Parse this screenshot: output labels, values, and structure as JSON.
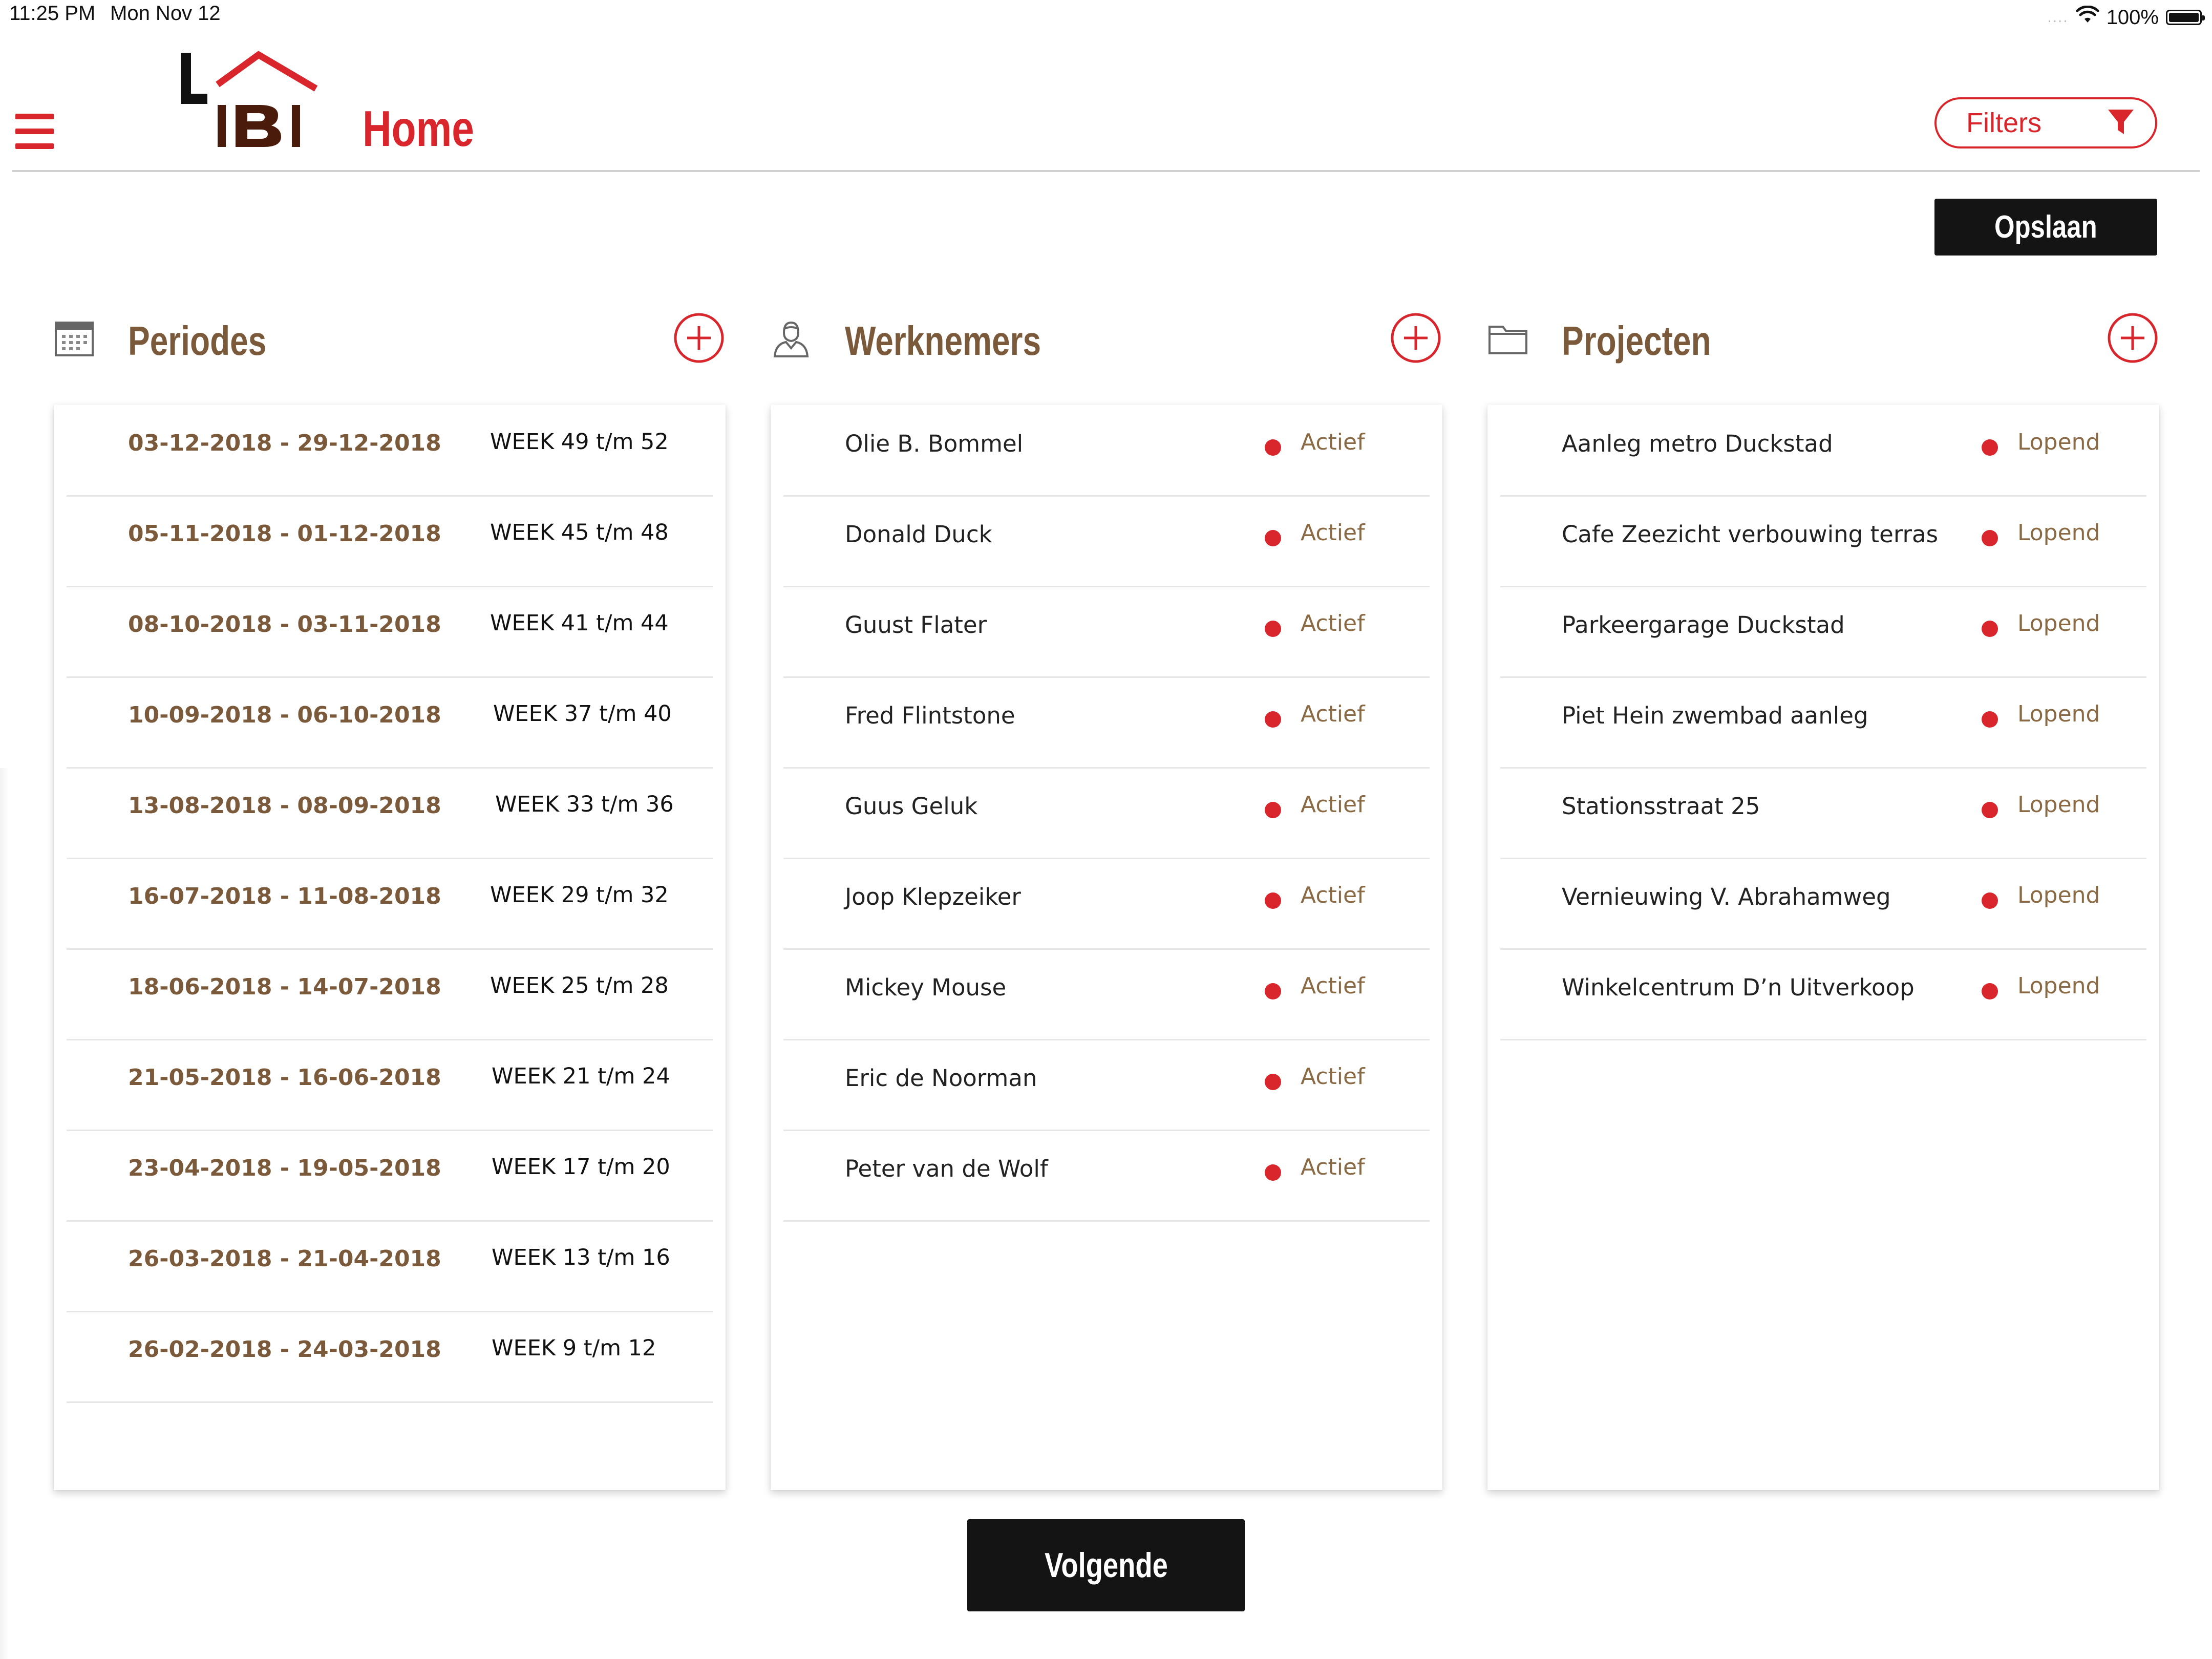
{
  "status_bar": {
    "time": "11:25 PM",
    "date": "Mon Nov 12",
    "signal": "....",
    "battery": "100%"
  },
  "header": {
    "title": "Home",
    "filters_label": "Filters",
    "save_label": "Opslaan"
  },
  "colors": {
    "accent": "#d8262c",
    "brown": "#7a5a3a",
    "dark": "#141414"
  },
  "columns": {
    "periodes": {
      "title": "Periodes",
      "icon": "calendar-icon",
      "rows": [
        {
          "range": "03-12-2018 - 29-12-2018",
          "weeks": "WEEK 49 t/m 52"
        },
        {
          "range": "05-11-2018 - 01-12-2018",
          "weeks": "WEEK 45 t/m 48"
        },
        {
          "range": "08-10-2018 - 03-11-2018",
          "weeks": "WEEK 41 t/m 44"
        },
        {
          "range": "10-09-2018 - 06-10-2018",
          "weeks": "WEEK 37 t/m 40"
        },
        {
          "range": "13-08-2018 - 08-09-2018",
          "weeks": "WEEK 33 t/m 36"
        },
        {
          "range": "16-07-2018 - 11-08-2018",
          "weeks": "WEEK 29 t/m 32"
        },
        {
          "range": "18-06-2018 - 14-07-2018",
          "weeks": "WEEK 25 t/m 28"
        },
        {
          "range": "21-05-2018 - 16-06-2018",
          "weeks": "WEEK 21 t/m 24"
        },
        {
          "range": "23-04-2018 - 19-05-2018",
          "weeks": "WEEK 17 t/m 20"
        },
        {
          "range": "26-03-2018 - 21-04-2018",
          "weeks": "WEEK 13 t/m 16"
        },
        {
          "range": "26-02-2018 - 24-03-2018",
          "weeks": "WEEK 9 t/m 12"
        }
      ]
    },
    "werknemers": {
      "title": "Werknemers",
      "icon": "person-icon",
      "rows": [
        {
          "name": "Olie B. Bommel",
          "status": "Actief"
        },
        {
          "name": "Donald Duck",
          "status": "Actief"
        },
        {
          "name": "Guust Flater",
          "status": "Actief"
        },
        {
          "name": "Fred Flintstone",
          "status": "Actief"
        },
        {
          "name": "Guus Geluk",
          "status": "Actief"
        },
        {
          "name": "Joop Klepzeiker",
          "status": "Actief"
        },
        {
          "name": "Mickey Mouse",
          "status": "Actief"
        },
        {
          "name": "Eric de Noorman",
          "status": "Actief"
        },
        {
          "name": "Peter van de Wolf",
          "status": "Actief"
        }
      ]
    },
    "projecten": {
      "title": "Projecten",
      "icon": "folder-icon",
      "rows": [
        {
          "name": "Aanleg metro Duckstad",
          "status": "Lopend"
        },
        {
          "name": "Cafe Zeezicht verbouwing terras",
          "status": "Lopend"
        },
        {
          "name": "Parkeergarage Duckstad",
          "status": "Lopend"
        },
        {
          "name": "Piet Hein zwembad aanleg",
          "status": "Lopend"
        },
        {
          "name": "Stationsstraat 25",
          "status": "Lopend"
        },
        {
          "name": "Vernieuwing V. Abrahamweg",
          "status": "Lopend"
        },
        {
          "name": "Winkelcentrum D’n Uitverkoop",
          "status": "Lopend"
        }
      ]
    }
  },
  "footer": {
    "next_label": "Volgende"
  }
}
